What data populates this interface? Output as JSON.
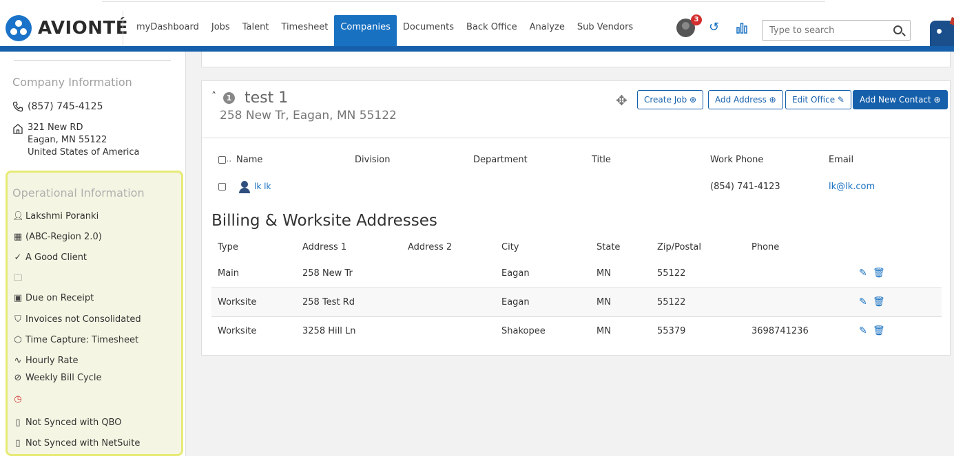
{
  "app": {
    "brand": "AVIONTÉ",
    "accent": "#1660ab"
  },
  "nav": {
    "items": [
      "myDashboard",
      "Jobs",
      "Talent",
      "Timesheet",
      "Companies",
      "Documents",
      "Back Office",
      "Analyze",
      "Sub Vendors"
    ],
    "active": "Companies"
  },
  "header": {
    "notification_count": "3",
    "search_placeholder": "Type to search"
  },
  "company_info": {
    "title": "Company Information",
    "phone": "(857) 745-4125",
    "address_line1": "321 New RD",
    "address_line2": "Eagan, MN 55122",
    "address_line3": "United States of America"
  },
  "operational_info": {
    "title": "Operational Information",
    "owner": "Lakshmi Poranki",
    "region": "(ABC-Region 2.0)",
    "status": "A Good Client",
    "terms": "Due on Receipt",
    "invoices": "Invoices not Consolidated",
    "time_capture": "Time Capture: Timesheet",
    "rate": "Hourly Rate",
    "bill_cycle": "Weekly Bill Cycle",
    "qbo": "Not Synced with QBO",
    "netsuite": "Not Synced with NetSuite"
  },
  "office": {
    "badge": "1",
    "name": "test 1",
    "address": "258 New Tr, Eagan, MN 55122",
    "buttons": {
      "create_job": "Create Job ⊕",
      "add_address": "Add Address ⊕",
      "edit_office": "Edit Office ✎",
      "add_contact": "Add New Contact ⊕"
    }
  },
  "contacts": {
    "headers": [
      "Name",
      "Division",
      "Department",
      "Title",
      "Work Phone",
      "Email"
    ],
    "rows": [
      {
        "name": "lk lk",
        "work_phone": "(854) 741-4123",
        "email": "lk@lk.com"
      }
    ]
  },
  "addresses": {
    "title": "Billing & Worksite Addresses",
    "headers": [
      "Type",
      "Address 1",
      "Address 2",
      "City",
      "State",
      "Zip/Postal",
      "Phone"
    ],
    "rows": [
      {
        "type": "Main",
        "address1": "258 New Tr",
        "address2": "",
        "city": "Eagan",
        "state": "MN",
        "zip": "55122",
        "phone": ""
      },
      {
        "type": "Worksite",
        "address1": "258 Test Rd",
        "address2": "",
        "city": "Eagan",
        "state": "MN",
        "zip": "55122",
        "phone": ""
      },
      {
        "type": "Worksite",
        "address1": "3258 Hill Ln",
        "address2": "",
        "city": "Shakopee",
        "state": "MN",
        "zip": "55379",
        "phone": "3698741236"
      }
    ]
  }
}
